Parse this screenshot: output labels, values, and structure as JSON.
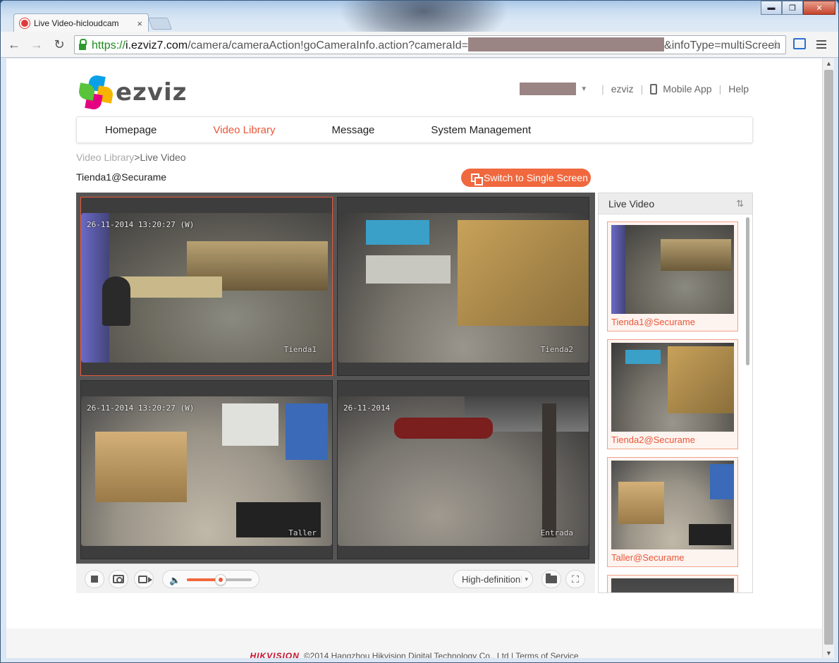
{
  "browser": {
    "tab_title": "Live Video-hicloudcam",
    "tab_close": "×",
    "url_scheme": "https://",
    "url_host": "i.ezviz7.com",
    "url_path": "/camera/cameraAction!goCameraInfo.action?cameraId=",
    "url_suffix": "&infoType=multiScreen",
    "minimize": "▬",
    "maximize": "❐",
    "close": "✕"
  },
  "header": {
    "logo_text": "ezviz",
    "user_link": "ezviz",
    "mobile_app": "Mobile App",
    "help": "Help",
    "sep": "|"
  },
  "nav": {
    "items": [
      {
        "label": "Homepage",
        "active": false
      },
      {
        "label": "Video Library",
        "active": true
      },
      {
        "label": "Message",
        "active": false
      },
      {
        "label": "System Management",
        "active": false
      }
    ]
  },
  "breadcrumb": {
    "parent": "Video Library",
    "sep": ">",
    "current": "Live Video"
  },
  "device_title": "Tienda1@Securame",
  "switch_button": "Switch to Single Screen",
  "feeds": [
    {
      "timestamp": "26-11-2014 13:20:27 (W)",
      "label": "Tienda1"
    },
    {
      "timestamp": "",
      "label": "Tienda2"
    },
    {
      "timestamp": "26-11-2014 13:20:27 (W)",
      "label": "Taller"
    },
    {
      "timestamp": "26-11-2014",
      "label": "Entrada"
    }
  ],
  "controls": {
    "quality": "High-definition",
    "quality_caret": "▾",
    "volume_level": 0.52
  },
  "side_panel": {
    "title": "Live Video",
    "cameras": [
      {
        "label": "Tienda1@Securame"
      },
      {
        "label": "Tienda2@Securame"
      },
      {
        "label": "Taller@Securame"
      },
      {
        "label": ""
      }
    ]
  },
  "footer": {
    "brand": "HIKVISION",
    "copyright": "©2014 Hangzhou Hikvision Digital Technology Co., Ltd",
    "sep": "|",
    "terms": "Terms of Service"
  },
  "colors": {
    "accent": "#e8583a",
    "button": "#f0683e"
  }
}
